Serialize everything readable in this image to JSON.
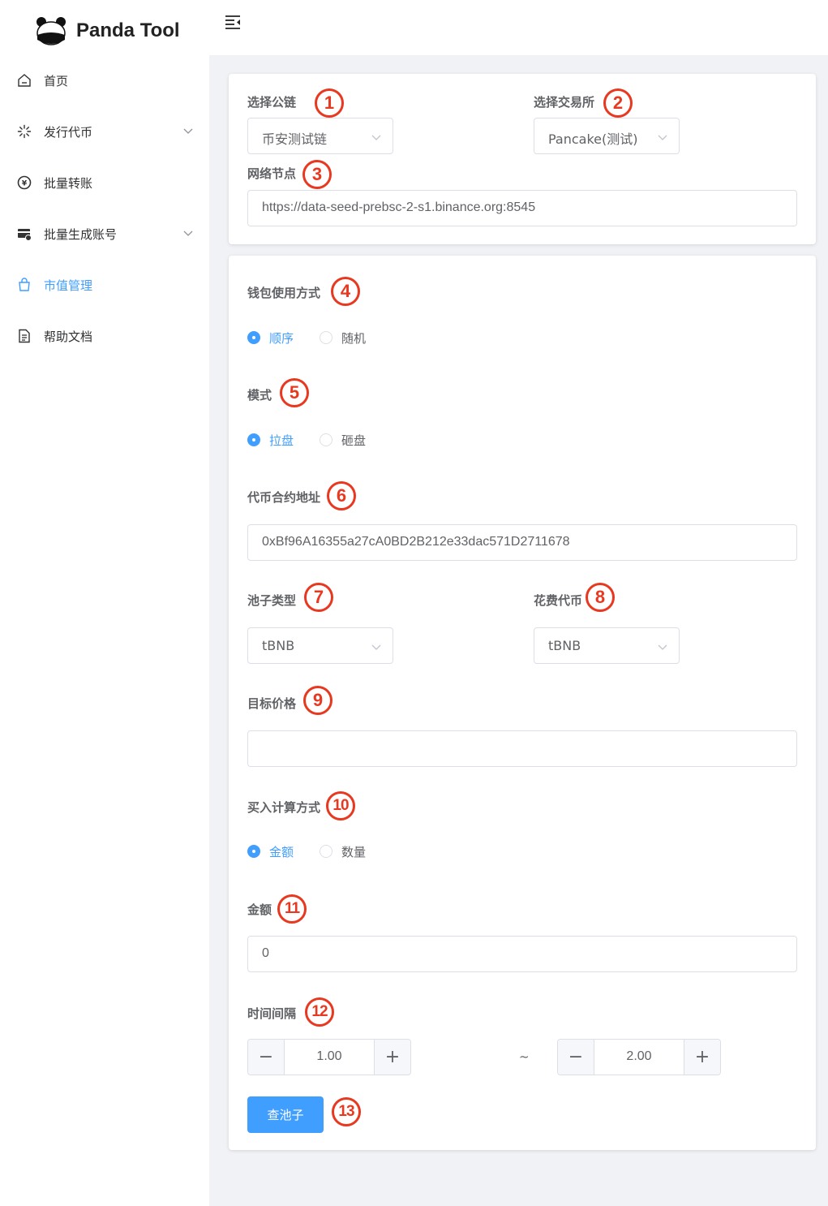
{
  "app": {
    "title": "Panda Tool"
  },
  "sidebar": {
    "items": [
      {
        "label": "首页",
        "icon": "home-icon"
      },
      {
        "label": "发行代币",
        "icon": "loading-icon"
      },
      {
        "label": "批量转账",
        "icon": "coin-icon"
      },
      {
        "label": "批量生成账号",
        "icon": "card-icon"
      },
      {
        "label": "市值管理",
        "icon": "shopping-bag-icon",
        "active": true
      },
      {
        "label": "帮助文档",
        "icon": "document-icon"
      }
    ]
  },
  "config": {
    "chain": {
      "label": "选择公链",
      "value": "币安测试链",
      "marker": "1"
    },
    "exchange": {
      "label": "选择交易所",
      "value": "Pancake(测试)",
      "marker": "2"
    },
    "node": {
      "label": "网络节点",
      "value": "https://data-seed-prebsc-2-s1.binance.org:8545",
      "marker": "3"
    }
  },
  "form": {
    "wallet_mode": {
      "label": "钱包使用方式",
      "marker": "4",
      "options": [
        "顺序",
        "随机"
      ],
      "selected": "顺序"
    },
    "mode": {
      "label": "模式",
      "marker": "5",
      "options": [
        "拉盘",
        "砸盘"
      ],
      "selected": "拉盘"
    },
    "token_address": {
      "label": "代币合约地址",
      "marker": "6",
      "value": "0xBf96A16355a27cA0BD2B212e33dac571D2711678"
    },
    "pool_type": {
      "label": "池子类型",
      "marker": "7",
      "value": "tBNB"
    },
    "spend_token": {
      "label": "花费代币",
      "marker": "8",
      "value": "tBNB"
    },
    "target_price": {
      "label": "目标价格",
      "marker": "9",
      "value": ""
    },
    "buy_calc": {
      "label": "买入计算方式",
      "marker": "10",
      "options": [
        "金额",
        "数量"
      ],
      "selected": "金额"
    },
    "amount": {
      "label": "金额",
      "marker": "11",
      "value": "0"
    },
    "interval": {
      "label": "时间间隔",
      "marker": "12",
      "min": "1.00",
      "max": "2.00",
      "separator": "~",
      "minus": "−",
      "plus": "+"
    },
    "submit": {
      "label": "查池子",
      "marker": "13"
    }
  },
  "colors": {
    "primary": "#409eff",
    "marker": "#e8381f",
    "background": "#f0f2f5"
  }
}
